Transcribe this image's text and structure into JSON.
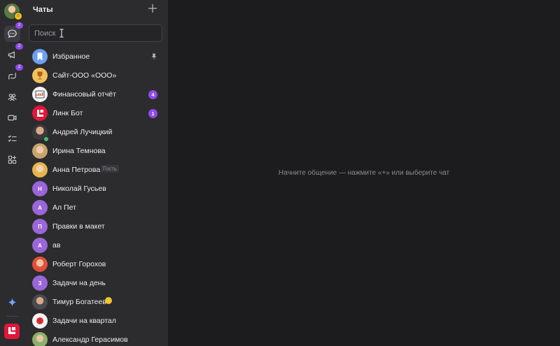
{
  "rail": {
    "items": [
      {
        "name": "chats",
        "badge": "2"
      },
      {
        "name": "channels",
        "badge": "2"
      },
      {
        "name": "threads",
        "badge": "2"
      },
      {
        "name": "contacts",
        "badge": ""
      },
      {
        "name": "calls",
        "badge": ""
      },
      {
        "name": "tasks",
        "badge": ""
      },
      {
        "name": "apps",
        "badge": ""
      }
    ],
    "accent": "#8f4ae8",
    "brand_color": "#e3163a"
  },
  "sidebar": {
    "title": "Чаты",
    "search_placeholder": "Поиск",
    "chats": [
      {
        "name": "Избранное",
        "avatar": "bookmark-icon",
        "pinned": true
      },
      {
        "name": "Сайт-ООО «ООО»",
        "avatar": "trophy-icon"
      },
      {
        "name": "Финансовый отчёт",
        "avatar": "report-icon",
        "unread": "4"
      },
      {
        "name": "Линк Бот",
        "avatar": "bot-logo-icon",
        "unread": "1"
      },
      {
        "name": "Андрей Лучицкий",
        "avatar": "photo",
        "online": true
      },
      {
        "name": "Ирина Темнова",
        "avatar": "photo"
      },
      {
        "name": "Анна Петрова",
        "avatar": "photo",
        "tag": "Гость"
      },
      {
        "name": "Николай Гусьев",
        "initial": "Н"
      },
      {
        "name": "Ал Пет",
        "initial": "А"
      },
      {
        "name": "Правки в макет",
        "initial": "П"
      },
      {
        "name": "ав",
        "initial": "А"
      },
      {
        "name": "Роберт Горохов",
        "avatar": "photo"
      },
      {
        "name": "Задачи на день",
        "initial": "З"
      },
      {
        "name": "Тимур Богатеев",
        "avatar": "photo",
        "emoji": "smile"
      },
      {
        "name": "Задачи на квартал",
        "avatar": "photo"
      },
      {
        "name": "Александр Герасимов",
        "avatar": "photo"
      }
    ]
  },
  "main": {
    "empty_hint": "Начните общение — нажмите «+» или выберите чат"
  }
}
